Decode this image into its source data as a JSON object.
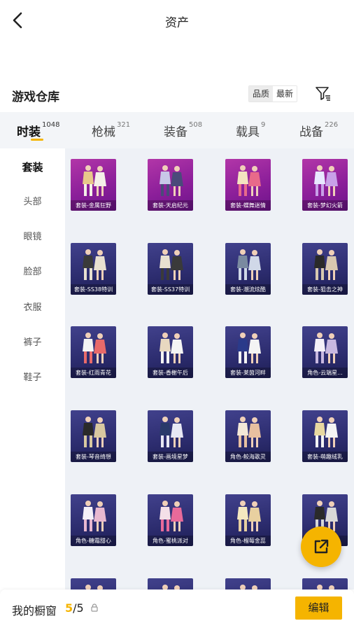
{
  "header": {
    "title": "资产",
    "back_icon": "chevron-left-icon"
  },
  "section": {
    "title": "游戏仓库",
    "sort_options": [
      {
        "label": "品质",
        "active": true
      },
      {
        "label": "最新",
        "active": false
      }
    ],
    "filter_icon": "filter-list-icon"
  },
  "category_tabs": [
    {
      "label": "时装",
      "count": "1048",
      "active": true
    },
    {
      "label": "枪械",
      "count": "321",
      "active": false
    },
    {
      "label": "装备",
      "count": "508",
      "active": false
    },
    {
      "label": "载具",
      "count": "9",
      "active": false
    },
    {
      "label": "战备",
      "count": "226",
      "active": false
    }
  ],
  "sidebar": {
    "items": [
      {
        "label": "套装",
        "active": true
      },
      {
        "label": "头部",
        "active": false
      },
      {
        "label": "眼镜",
        "active": false
      },
      {
        "label": "脸部",
        "active": false
      },
      {
        "label": "衣服",
        "active": false
      },
      {
        "label": "裤子",
        "active": false
      },
      {
        "label": "鞋子",
        "active": false
      }
    ]
  },
  "items": [
    {
      "label": "套装-金属狂野",
      "tier": "purple"
    },
    {
      "label": "套装-天启纪元",
      "tier": "purple"
    },
    {
      "label": "套装-蝶舞迷情",
      "tier": "purple"
    },
    {
      "label": "套装-梦幻火箭",
      "tier": "purple"
    },
    {
      "label": "套装-SS38特训",
      "tier": "navy"
    },
    {
      "label": "套装-SS37特训",
      "tier": "navy"
    },
    {
      "label": "套装-潮流炫酷",
      "tier": "navy"
    },
    {
      "label": "套装-狙击之神",
      "tier": "navy"
    },
    {
      "label": "套装-红雨青花",
      "tier": "navy"
    },
    {
      "label": "套装-香榭午后",
      "tier": "navy"
    },
    {
      "label": "套装-莱茵河畔",
      "tier": "navy"
    },
    {
      "label": "角色-云端星...",
      "tier": "navy"
    },
    {
      "label": "套装-琴音绮想",
      "tier": "navy"
    },
    {
      "label": "套装-画境星梦",
      "tier": "navy"
    },
    {
      "label": "角色-鲛海歌灵",
      "tier": "navy"
    },
    {
      "label": "套装-萌趣绒乳",
      "tier": "navy"
    },
    {
      "label": "角色-糖霜甜心",
      "tier": "navy"
    },
    {
      "label": "角色-蜜桃派对",
      "tier": "navy"
    },
    {
      "label": "角色-榴莓金蕊",
      "tier": "navy"
    },
    {
      "label": "",
      "tier": "navy"
    },
    {
      "label": "",
      "tier": "navy"
    },
    {
      "label": "",
      "tier": "navy"
    },
    {
      "label": "",
      "tier": "navy"
    },
    {
      "label": "",
      "tier": "navy"
    }
  ],
  "share_fab": {
    "icon": "share-external-icon"
  },
  "bottom": {
    "label": "我的橱窗",
    "used": "5",
    "separator": "/",
    "total": "5",
    "lock_icon": "lock-icon",
    "edit_label": "编辑"
  },
  "colors": {
    "accent": "#f5b400",
    "purple_tier": "#9b2aa0",
    "navy_tier": "#2e2e72"
  }
}
